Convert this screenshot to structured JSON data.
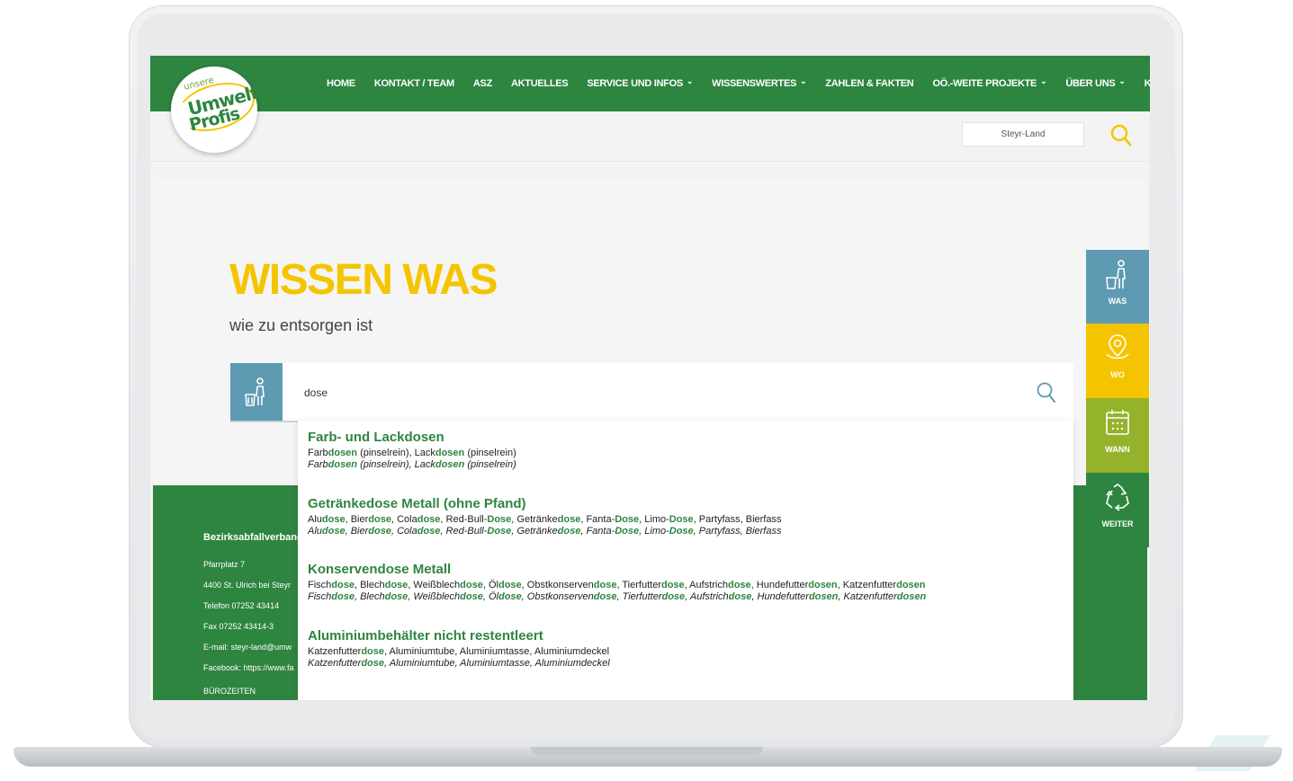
{
  "header": {
    "logo": {
      "line1": "unsere",
      "line2": "Umwelt",
      "line3": "Profis"
    },
    "nav": [
      {
        "label": "HOME",
        "dropdown": false
      },
      {
        "label": "KONTAKT / TEAM",
        "dropdown": false
      },
      {
        "label": "ASZ",
        "dropdown": false
      },
      {
        "label": "AKTUELLES",
        "dropdown": false
      },
      {
        "label": "SERVICE UND INFOS",
        "dropdown": true
      },
      {
        "label": "WISSENSWERTES",
        "dropdown": true
      },
      {
        "label": "ZAHLEN & FAKTEN",
        "dropdown": false
      },
      {
        "label": "OÖ.-WEITE PROJEKTE",
        "dropdown": true
      },
      {
        "label": "ÜBER UNS",
        "dropdown": true
      },
      {
        "label": "KARRIERE",
        "dropdown": false
      }
    ],
    "region": "Steyr-Land"
  },
  "hero": {
    "title": "WISSEN WAS",
    "subtitle": "wie zu entsorgen ist"
  },
  "search": {
    "value": "dose"
  },
  "results": [
    {
      "title": "Farb- und Lackdosen",
      "line": [
        [
          "Farb",
          ""
        ],
        [
          "dosen",
          "b"
        ],
        [
          " (pinselrein), Lack",
          ""
        ],
        [
          "dosen",
          "b"
        ],
        [
          " (pinselrein)",
          ""
        ]
      ]
    },
    {
      "title": "Getränkedose Metall (ohne Pfand)",
      "line": [
        [
          "Alu",
          ""
        ],
        [
          "dose",
          "b"
        ],
        [
          ", Bier",
          ""
        ],
        [
          "dose",
          "b"
        ],
        [
          ", Cola",
          ""
        ],
        [
          "dose",
          "b"
        ],
        [
          ", Red-Bull-",
          ""
        ],
        [
          "Dose",
          "b"
        ],
        [
          ", Getränke",
          ""
        ],
        [
          "dose",
          "b"
        ],
        [
          ", Fanta-",
          ""
        ],
        [
          "Dose",
          "b"
        ],
        [
          ", Limo-",
          ""
        ],
        [
          "Dose",
          "b"
        ],
        [
          ", Partyfass, Bierfass",
          ""
        ]
      ]
    },
    {
      "title": "Konservendose Metall",
      "line": [
        [
          "Fisch",
          ""
        ],
        [
          "dose",
          "b"
        ],
        [
          ", Blech",
          ""
        ],
        [
          "dose",
          "b"
        ],
        [
          ", Weißblech",
          ""
        ],
        [
          "dose",
          "b"
        ],
        [
          ", Öl",
          ""
        ],
        [
          "dose",
          "b"
        ],
        [
          ", Obstkonserven",
          ""
        ],
        [
          "dose",
          "b"
        ],
        [
          ", Tierfutter",
          ""
        ],
        [
          "dose",
          "b"
        ],
        [
          ", Aufstrich",
          ""
        ],
        [
          "dose",
          "b"
        ],
        [
          ", Hundefutter",
          ""
        ],
        [
          "dosen",
          "b"
        ],
        [
          ", Katzenfutter",
          ""
        ],
        [
          "dosen",
          "b"
        ]
      ]
    },
    {
      "title": "Aluminiumbehälter nicht restentleert",
      "line": [
        [
          "Katzenfutter",
          ""
        ],
        [
          "dose",
          "b"
        ],
        [
          ", Aluminiumtube, Aluminiumtasse, Aluminiumdeckel",
          ""
        ]
      ]
    }
  ],
  "footer": {
    "org": "Bezirksabfallverband",
    "lines": [
      "Pfarrplatz 7",
      "4400 St. Ulrich bei Steyr",
      "Telefon 07252 43414",
      "Fax 07252 43414-3",
      "E-mail: steyr-land@umw",
      "Facebook: https://www.fa",
      "BÜROZEITEN"
    ]
  },
  "sidepanel": [
    {
      "label": "WAS",
      "color": "#5e9bb3",
      "icon": "trash-person-icon"
    },
    {
      "label": "WO",
      "color": "#f5c400",
      "icon": "map-pin-icon"
    },
    {
      "label": "WANN",
      "color": "#95b32a",
      "icon": "calendar-icon"
    },
    {
      "label": "WEITER",
      "color": "#2e8540",
      "icon": "recycle-icon"
    }
  ],
  "colors": {
    "brand_green": "#2e8540",
    "accent_yellow": "#f5c400",
    "blue": "#5e9bb3",
    "lime": "#95b32a"
  }
}
